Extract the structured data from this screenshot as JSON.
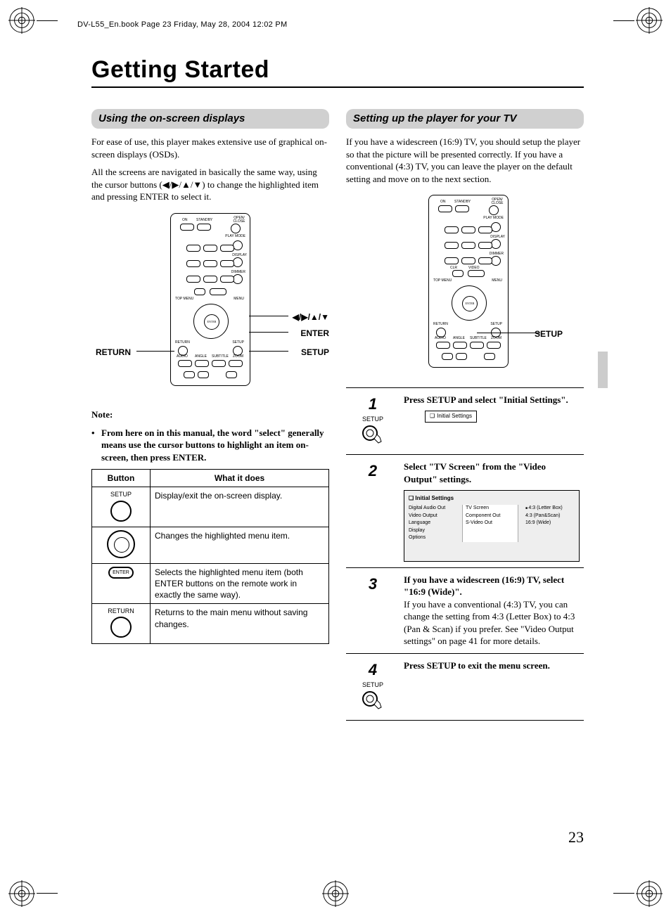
{
  "meta": {
    "header": "DV-L55_En.book  Page 23  Friday, May 28, 2004  12:02 PM"
  },
  "title": "Getting Started",
  "page_number": "23",
  "left": {
    "head": "Using the on-screen displays",
    "para1": "For ease of use, this player makes extensive use of graphical on-screen displays (OSDs).",
    "para2": "All the screens are navigated in basically the same way, using the cursor buttons (◀/▶/▲/▼) to change the highlighted item and pressing ENTER to select it.",
    "callouts": {
      "arrows": "◀/▶/▲/▼",
      "enter": "ENTER",
      "setup": "SETUP",
      "return": "RETURN"
    },
    "note_head": "Note:",
    "note_body": "From here on in this manual, the word \"select\" generally means use the cursor buttons to highlight an item on-screen, then press ENTER.",
    "table": {
      "h1": "Button",
      "h2": "What it does",
      "rows": [
        {
          "btn_label": "SETUP",
          "desc": "Display/exit the on-screen display."
        },
        {
          "btn_label": "",
          "desc": "Changes the highlighted menu item."
        },
        {
          "btn_label": "ENTER",
          "desc": "Selects the highlighted menu item (both ENTER buttons on the remote work in exactly the same way)."
        },
        {
          "btn_label": "RETURN",
          "desc": "Returns to the main menu without saving changes."
        }
      ]
    }
  },
  "right": {
    "head": "Setting up the player for your TV",
    "para1": "If you have a widescreen (16:9) TV, you should setup the player so that the picture will be presented correctly. If you have a conventional (4:3) TV, you can leave the player on the default setting and move on to the next section.",
    "callout_setup": "SETUP",
    "steps": [
      {
        "num": "1",
        "icon_label": "SETUP",
        "title": "Press SETUP and select \"Initial Settings\".",
        "body": "",
        "osd_tag": "Initial Settings"
      },
      {
        "num": "2",
        "icon_label": "",
        "title": "Select \"TV Screen\" from the \"Video Output\" settings.",
        "body": "",
        "osd": {
          "title": "Initial Settings",
          "left": [
            "Digital Audio Out",
            "Video Output",
            "Language",
            "Display",
            "Options"
          ],
          "mid": [
            "TV Screen",
            "Component Out",
            "S-Video Out"
          ],
          "right": [
            "4:3 (Letter Box)",
            "4:3 (Pan&Scan)",
            "16:9 (Wide)"
          ]
        }
      },
      {
        "num": "3",
        "icon_label": "",
        "title": "If you have a widescreen (16:9) TV, select \"16:9 (Wide)\".",
        "body": "If you have a conventional (4:3) TV, you can change the setting from 4:3 (Letter Box) to 4:3 (Pan & Scan) if you prefer. See \"Video Output settings\" on page 41 for more details."
      },
      {
        "num": "4",
        "icon_label": "SETUP",
        "title": "Press SETUP to exit the menu screen.",
        "body": ""
      }
    ]
  },
  "remote_labels": {
    "on": "ON",
    "standby": "STANDBY",
    "open": "OPEN/\nCLOSE",
    "playmode": "PLAY\nMODE",
    "display": "DISPLAY",
    "dimmer": "DIMMER",
    "topmenu": "TOP MENU",
    "menu": "MENU",
    "return": "RETURN",
    "setup": "SETUP",
    "audio": "AUDIO",
    "angle": "ANGLE",
    "subtitle": "SUBTITLE",
    "zoom": "ZOOM",
    "enter": "ENTER",
    "clr": "CLR",
    "video": "VIDEO"
  }
}
